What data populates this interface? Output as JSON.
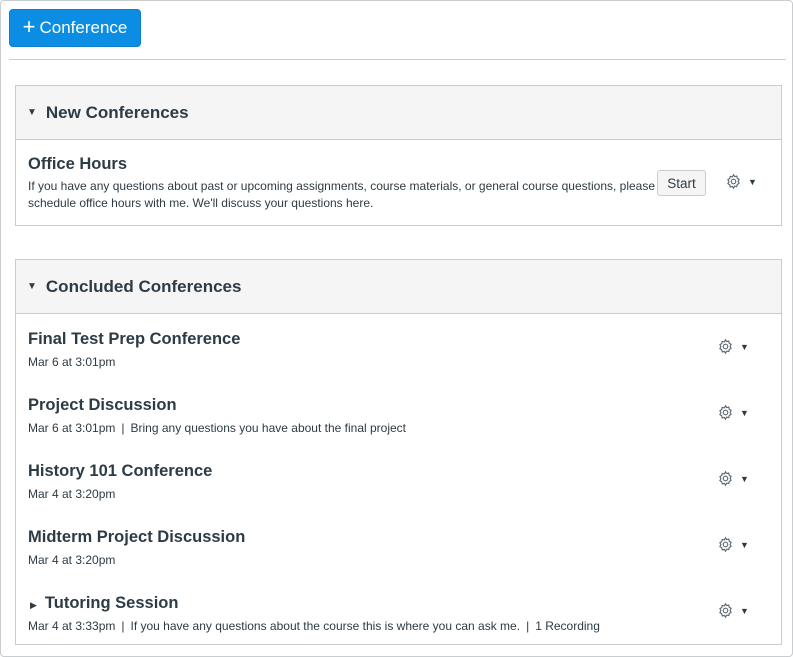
{
  "toolbar": {
    "add_label": "Conference",
    "add_icon": "plus-icon"
  },
  "new_section": {
    "title": "New Conferences",
    "items": [
      {
        "title": "Office Hours",
        "description_line1": "If you have any questions about past or upcoming assignments, course materials, or general course questions, please",
        "description_line2": "schedule office hours with me. We'll discuss your questions here.",
        "start_label": "Start"
      }
    ]
  },
  "concluded_section": {
    "title": "Concluded Conferences",
    "items": [
      {
        "title": "Final Test Prep Conference",
        "date": "Mar 6 at 3:01pm"
      },
      {
        "title": "Project Discussion",
        "date": "Mar 6 at 3:01pm",
        "description": "Bring any questions you have about the final project"
      },
      {
        "title": "History 101 Conference",
        "date": "Mar 4 at 3:20pm"
      },
      {
        "title": "Midterm Project Discussion",
        "date": "Mar 4 at 3:20pm"
      },
      {
        "title": "Tutoring Session",
        "date": "Mar 4 at 3:33pm",
        "description": "If you have any questions about the course this is where you can ask me.",
        "recordings": "1 Recording"
      }
    ]
  },
  "separator": "|",
  "colors": {
    "accent": "#0b8de3",
    "text": "#2d3b45",
    "border": "#c7cdd1",
    "header_bg": "#f5f5f5"
  }
}
